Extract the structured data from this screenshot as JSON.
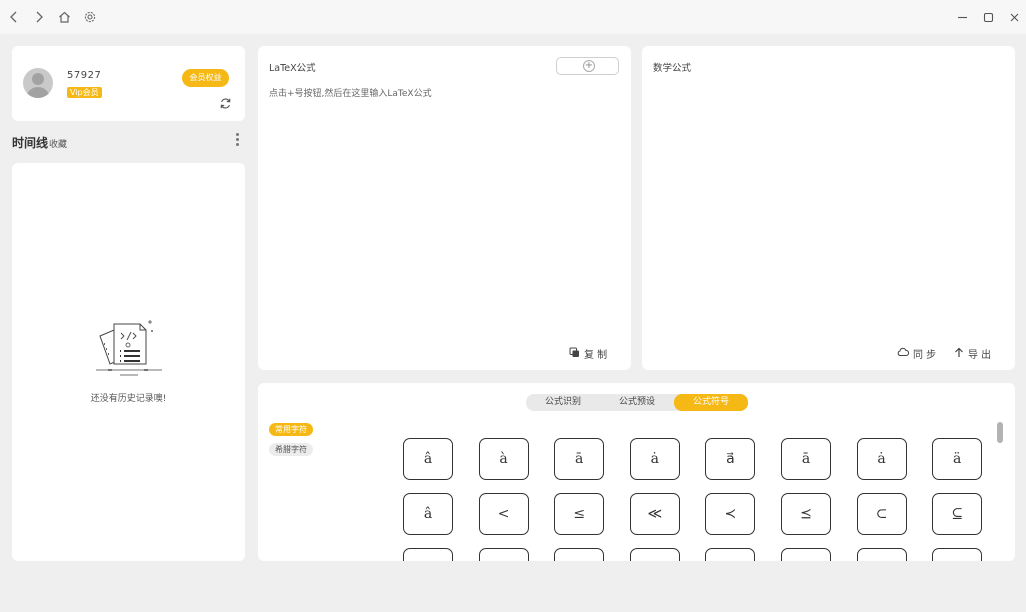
{
  "titlebar": {
    "nav_icons": [
      "chevron-left-icon",
      "chevron-right-icon",
      "home-icon",
      "gear-icon"
    ],
    "window_controls": [
      "minimize-icon",
      "maximize-icon",
      "close-icon"
    ]
  },
  "user": {
    "id": "57927",
    "vip_label": "Vip会员",
    "benefits_button": "会员权益"
  },
  "timeline": {
    "title": "时间线",
    "favorites": "收藏",
    "empty_text": "还没有历史记录噢!"
  },
  "latex_panel": {
    "title": "LaTeX公式",
    "hint": "点击+号按钮,然后在这里输入LaTeX公式",
    "copy_label": "复 制"
  },
  "math_panel": {
    "title": "数学公式",
    "sync_label": "同 步",
    "export_label": "导 出"
  },
  "symbol_panel": {
    "tabs": [
      {
        "label": "公式识别",
        "active": false
      },
      {
        "label": "公式预设",
        "active": false
      },
      {
        "label": "公式符号",
        "active": true
      }
    ],
    "categories": [
      {
        "label": "常用字符",
        "active": true
      },
      {
        "label": "希腊字符",
        "active": false
      }
    ],
    "symbols": [
      [
        "â",
        "à",
        "ā",
        "ȧ",
        "a⃗",
        "ā",
        "ȧ",
        "ä"
      ],
      [
        "â",
        "<",
        "≤",
        "≪",
        "≺",
        "⪯",
        "⊂",
        "⊆"
      ],
      [
        "",
        "",
        "",
        "",
        "",
        "",
        "",
        ""
      ]
    ]
  },
  "colors": {
    "accent": "#f6b814",
    "background": "#efefef",
    "card": "#ffffff"
  }
}
